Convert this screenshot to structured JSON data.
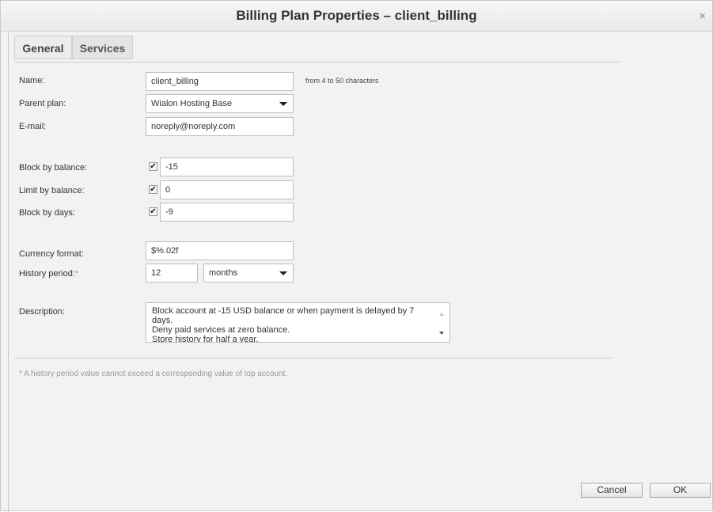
{
  "window": {
    "title": "Billing Plan Properties – client_billing"
  },
  "tabs": [
    {
      "label": "General"
    },
    {
      "label": "Services"
    }
  ],
  "form": {
    "name": {
      "label": "Name:",
      "value": "client_billing",
      "hint": "from 4 to 50 characters"
    },
    "parent_plan": {
      "label": "Parent plan:",
      "value": "Wialon Hosting Base"
    },
    "email": {
      "label": "E-mail:",
      "value": "noreply@noreply.com"
    },
    "block_by_balance": {
      "label": "Block by balance:",
      "checked": true,
      "value": "-15"
    },
    "limit_by_balance": {
      "label": "Limit by balance:",
      "checked": true,
      "value": "0"
    },
    "block_by_days": {
      "label": "Block by days:",
      "checked": true,
      "value": "-9"
    },
    "currency_format": {
      "label": "Currency format:",
      "value": "$%.02f"
    },
    "history_period": {
      "label": "History period:",
      "required_mark": "*",
      "value": "12",
      "unit": "months"
    },
    "description": {
      "label": "Description:",
      "value": "Block account at -15 USD balance or when payment is delayed by 7 days.\nDeny paid services at zero balance.\nStore history for half a year."
    }
  },
  "footnote": "* A history period value cannot exceed a corresponding value of top account.",
  "buttons": {
    "cancel": "Cancel",
    "ok": "OK"
  }
}
